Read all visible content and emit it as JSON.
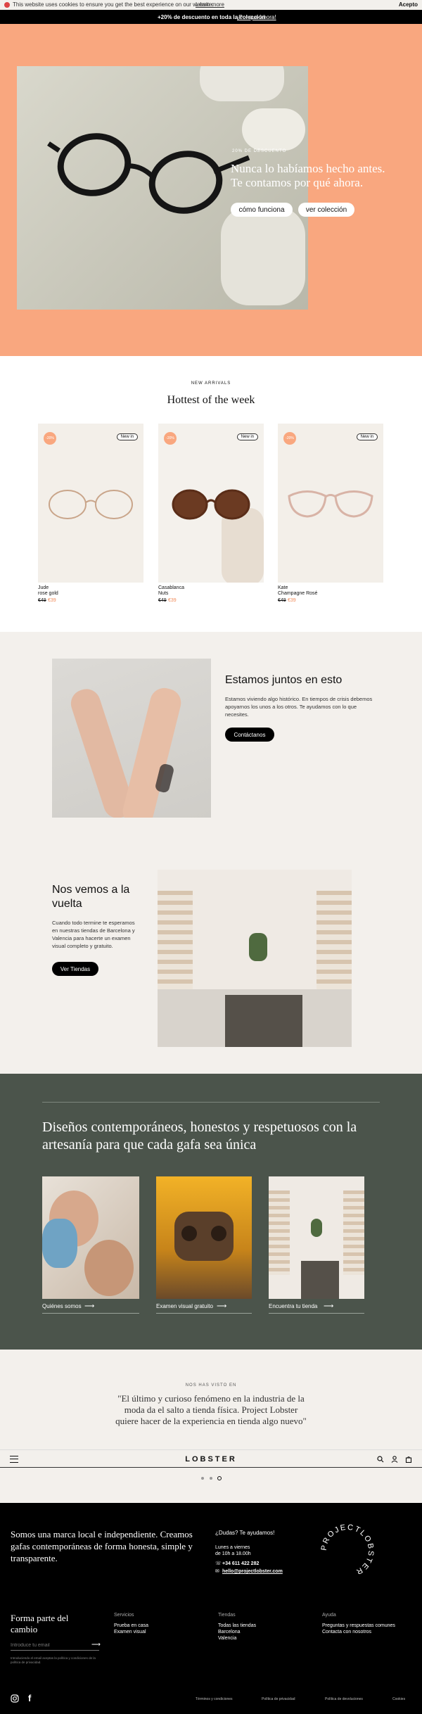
{
  "cookie": {
    "text": "This website uses cookies to ensure you get the best experience on our website.",
    "learn_more": "Learn more",
    "accept": "Acepto"
  },
  "promo": {
    "bold": "+20% de descuento en toda la colección",
    "link": "¡Por qué ahora!"
  },
  "hero": {
    "eyebrow": "20% DE DESCUENTO",
    "title_line1": "Nunca lo habíamos hecho antes.",
    "title_line2": "Te contamos por qué ahora.",
    "btn_how": "cómo funciona",
    "btn_collection": "ver colección",
    "bg": "#f9a77f"
  },
  "arrivals": {
    "eyebrow": "NEW ARRIVALS",
    "title": "Hottest of the week",
    "products": [
      {
        "badge": "-20%",
        "tag": "New in",
        "name": "Jude",
        "variant": "rose gold",
        "old": "€49",
        "price": "€39"
      },
      {
        "badge": "-20%",
        "tag": "New in",
        "name": "Casablanca",
        "variant": "Nuts",
        "old": "€49",
        "price": "€39"
      },
      {
        "badge": "-20%",
        "tag": "New in",
        "name": "Kate",
        "variant": "Champagne Rosé",
        "old": "€49",
        "price": "€39"
      }
    ]
  },
  "together": {
    "title": "Estamos juntos en esto",
    "body": "Estamos viviendo algo histórico. En tiempos de crisis debemos apoyarnos los unos a los otros. Te ayudamos con lo que necesites.",
    "btn": "Contáctanos"
  },
  "back": {
    "title": "Nos vemos a la vuelta",
    "body": "Cuando todo termine te esperamos en nuestras tiendas de Barcelona y Valencia para hacerte un examen visual completo y gratuito.",
    "btn": "Ver Tiendas"
  },
  "designs": {
    "title": "Diseños contemporáneos, honestos y respetuosos con la artesanía para que cada gafa sea única",
    "cards": [
      {
        "label": "Quiénes somos"
      },
      {
        "label": "Examen visual gratuito"
      },
      {
        "label": "Encuentra tu tienda"
      }
    ]
  },
  "press": {
    "eyebrow": "NOS HAS VISTO EN",
    "quote": "\"El último y curioso fenómeno en la industria de la moda da el salto a tienda física. Project Lobster quiere hacer de la experiencia en tienda algo nuevo\""
  },
  "nav": {
    "logo": "LOBSTER"
  },
  "footer": {
    "intro": "Somos una marca local e independiente. Creamos gafas contemporáneas de forma honesta, simple y transparente.",
    "help_title": "¿Dudas? Te ayudamos!",
    "hours1": "Lunes a viernes",
    "hours2": "de 10h a 18.00h",
    "phone": "+34 611 422 282",
    "email": "hello@projectlobster.com",
    "badge_text": "PROJECTLOBSTER",
    "change_title": "Forma parte del cambio",
    "email_placeholder": "Introduce tu email",
    "legal_note": "Introduciendo el email aceptas la política y condiciones de la política de privacidad.",
    "cols": [
      {
        "title": "Servicios",
        "items": [
          "Prueba en casa",
          "Examen visual"
        ]
      },
      {
        "title": "Tiendas",
        "items": [
          "Todas las tiendas",
          "Barcelona",
          "Valencia"
        ]
      },
      {
        "title": "Ayuda",
        "items": [
          "Preguntas y respuestas comunes",
          "Contacta con nosotros"
        ]
      }
    ],
    "bottom_links": [
      "Términos y condiciones",
      "Política de privacidad",
      "Política de devoluciones",
      "Cookies"
    ]
  }
}
